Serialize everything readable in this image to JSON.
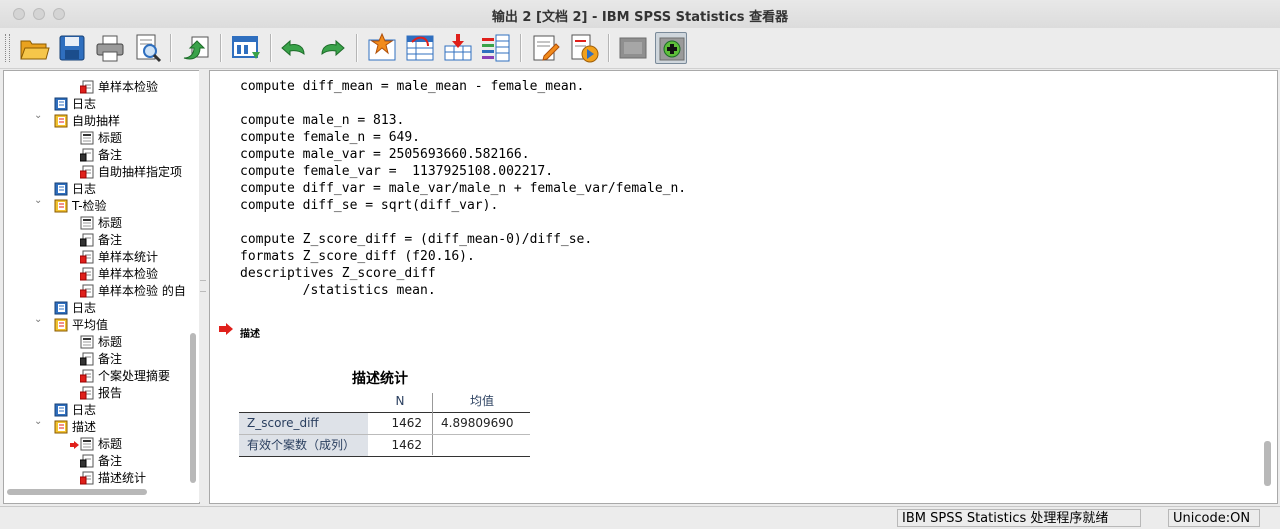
{
  "window": {
    "title": "输出 2 [文档 2] - IBM SPSS Statistics 查看器"
  },
  "toolbar": {
    "buttons": [
      {
        "name": "open-icon"
      },
      {
        "name": "save-icon"
      },
      {
        "name": "print-icon"
      },
      {
        "name": "print-preview-icon"
      },
      {
        "name": "export-icon"
      },
      {
        "name": "recall-dialog-icon"
      },
      {
        "name": "undo-icon"
      },
      {
        "name": "redo-icon"
      },
      {
        "name": "goto-data-icon"
      },
      {
        "name": "goto-case-icon"
      },
      {
        "name": "goto-variable-icon"
      },
      {
        "name": "variables-icon"
      },
      {
        "name": "edit-icon"
      },
      {
        "name": "designate-window-icon"
      },
      {
        "name": "hide-icon"
      },
      {
        "name": "show-icon"
      }
    ]
  },
  "nav": {
    "items": [
      {
        "label": "单样本检验",
        "icon": "table-icon",
        "level": 2
      },
      {
        "label": "日志",
        "icon": "log-icon",
        "level": 1
      },
      {
        "label": "自助抽样",
        "icon": "folder-icon",
        "level": 1
      },
      {
        "label": "标题",
        "icon": "title-icon",
        "level": 2
      },
      {
        "label": "备注",
        "icon": "notes-icon",
        "level": 2
      },
      {
        "label": "自助抽样指定项",
        "icon": "table-icon",
        "level": 2
      },
      {
        "label": "日志",
        "icon": "log-icon",
        "level": 1
      },
      {
        "label": "T-检验",
        "icon": "folder-icon",
        "level": 1
      },
      {
        "label": "标题",
        "icon": "title-icon",
        "level": 2
      },
      {
        "label": "备注",
        "icon": "notes-icon",
        "level": 2
      },
      {
        "label": "单样本统计",
        "icon": "table-icon",
        "level": 2
      },
      {
        "label": "单样本检验",
        "icon": "table-icon",
        "level": 2
      },
      {
        "label": "单样本检验 的自",
        "icon": "table-icon",
        "level": 2
      },
      {
        "label": "日志",
        "icon": "log-icon",
        "level": 1
      },
      {
        "label": "平均值",
        "icon": "folder-icon",
        "level": 1
      },
      {
        "label": "标题",
        "icon": "title-icon",
        "level": 2
      },
      {
        "label": "备注",
        "icon": "notes-icon",
        "level": 2
      },
      {
        "label": "个案处理摘要",
        "icon": "table-icon",
        "level": 2
      },
      {
        "label": "报告",
        "icon": "table-icon",
        "level": 2
      },
      {
        "label": "日志",
        "icon": "log-icon",
        "level": 1
      },
      {
        "label": "描述",
        "icon": "folder-icon",
        "level": 1
      },
      {
        "label": "标题",
        "icon": "title-icon",
        "level": 2,
        "current": true
      },
      {
        "label": "备注",
        "icon": "notes-icon",
        "level": 2
      },
      {
        "label": "描述统计",
        "icon": "table-icon",
        "level": 2
      }
    ]
  },
  "syntax": [
    "compute diff_mean = male_mean - female_mean.",
    "",
    "compute male_n = 813.",
    "compute female_n = 649.",
    "compute male_var = 2505693660.582166.",
    "compute female_var =  1137925108.002217.",
    "compute diff_var = male_var/male_n + female_var/female_n.",
    "compute diff_se = sqrt(diff_var).",
    "",
    "compute Z_score_diff = (diff_mean-0)/diff_se.",
    "formats Z_score_diff (f20.16).",
    "descriptives Z_score_diff",
    "        /statistics mean."
  ],
  "output": {
    "section_label": "描述",
    "table": {
      "title": "描述统计",
      "columns": [
        "N",
        "均值"
      ],
      "rows": [
        {
          "label": "Z_score_diff",
          "n": "1462",
          "mean": "4.89809690"
        },
        {
          "label": "有效个案数（成列）",
          "n": "1462",
          "mean": ""
        }
      ]
    }
  },
  "status": {
    "processor": "IBM SPSS Statistics 处理程序就绪",
    "unicode": "Unicode:ON"
  },
  "colors": {
    "accent_red": "#e0201b",
    "folder_yellow": "#f2c230",
    "book_blue": "#2f6fbf"
  }
}
